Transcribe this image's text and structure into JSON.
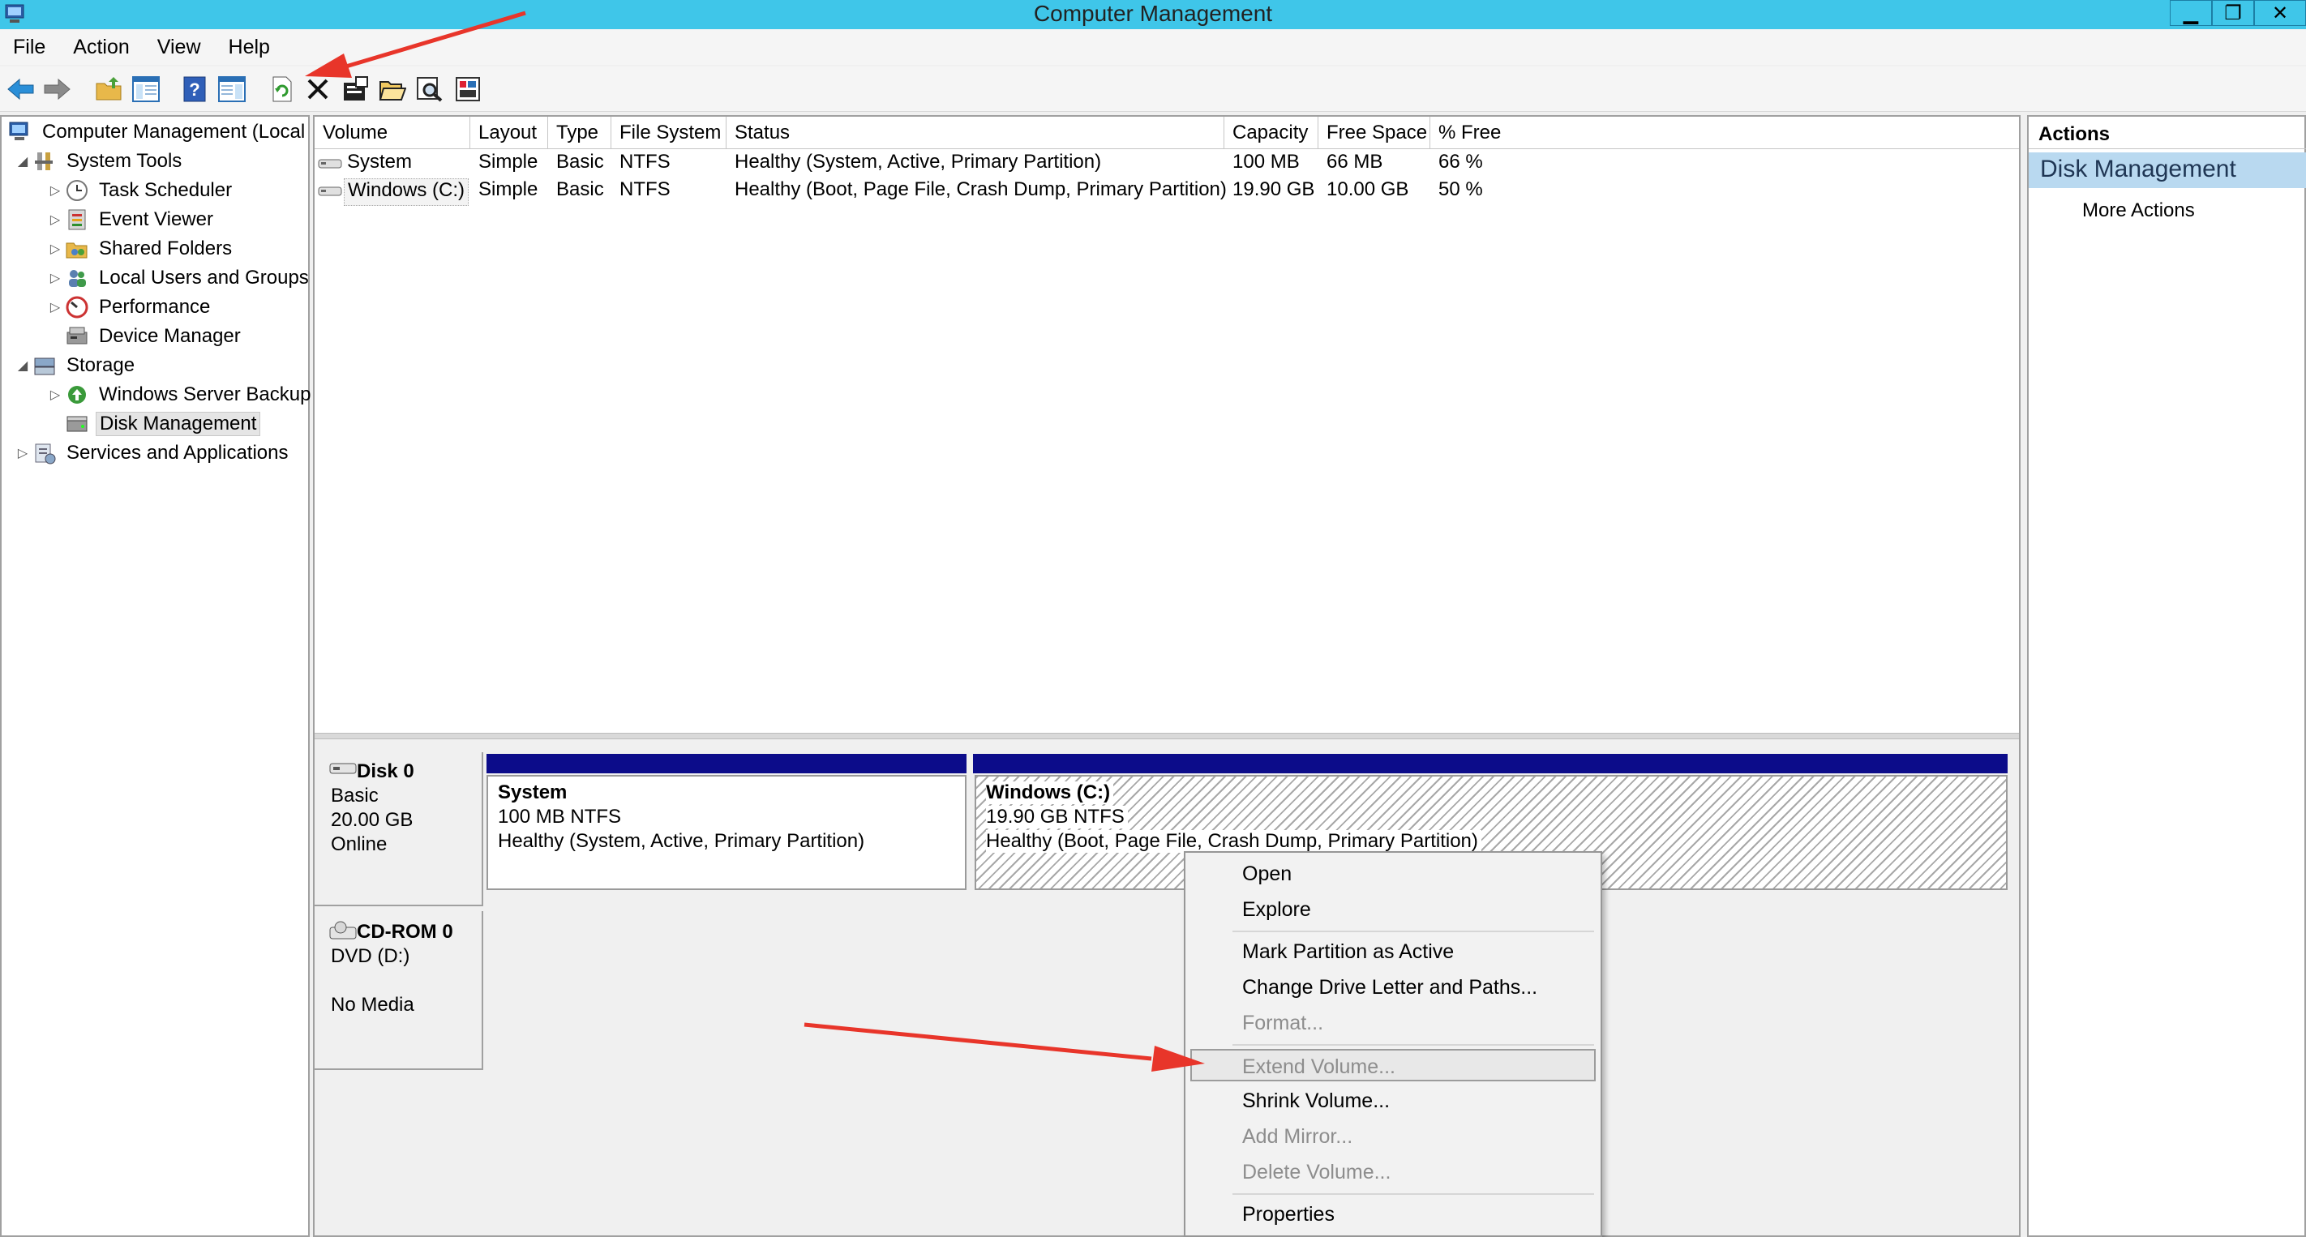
{
  "window": {
    "title": "Computer Management",
    "minimize_label": "▁",
    "restore_label": "❐",
    "close_label": "✕"
  },
  "menu": [
    "File",
    "Action",
    "View",
    "Help"
  ],
  "tree": [
    {
      "label": "Computer Management (Local",
      "icon": "computer-management-icon",
      "expander": ""
    },
    {
      "label": "System Tools",
      "icon": "system-tools-icon",
      "expander": "◢"
    },
    {
      "label": "Task Scheduler",
      "icon": "clock-icon",
      "expander": "▷"
    },
    {
      "label": "Event Viewer",
      "icon": "event-viewer-icon",
      "expander": "▷"
    },
    {
      "label": "Shared Folders",
      "icon": "shared-folders-icon",
      "expander": "▷"
    },
    {
      "label": "Local Users and Groups",
      "icon": "users-icon",
      "expander": "▷"
    },
    {
      "label": "Performance",
      "icon": "performance-icon",
      "expander": "▷"
    },
    {
      "label": "Device Manager",
      "icon": "device-manager-icon",
      "expander": ""
    },
    {
      "label": "Storage",
      "icon": "storage-icon",
      "expander": "◢"
    },
    {
      "label": "Windows Server Backup",
      "icon": "backup-icon",
      "expander": "▷"
    },
    {
      "label": "Disk Management",
      "icon": "disk-management-icon",
      "expander": ""
    },
    {
      "label": "Services and Applications",
      "icon": "services-icon",
      "expander": "▷"
    }
  ],
  "volume_table": {
    "columns": [
      "Volume",
      "Layout",
      "Type",
      "File System",
      "Status",
      "Capacity",
      "Free Space",
      "% Free"
    ],
    "rows": [
      [
        "System",
        "Simple",
        "Basic",
        "NTFS",
        "Healthy (System, Active, Primary Partition)",
        "100 MB",
        "66 MB",
        "66 %"
      ],
      [
        "Windows (C:)",
        "Simple",
        "Basic",
        "NTFS",
        "Healthy (Boot, Page File, Crash Dump, Primary Partition)",
        "19.90 GB",
        "10.00 GB",
        "50 %"
      ]
    ]
  },
  "disks": [
    {
      "name": "Disk 0",
      "lines": [
        "Basic",
        "20.00 GB",
        "Online"
      ]
    },
    {
      "name": "CD-ROM 0",
      "lines": [
        "DVD (D:)",
        "",
        "No Media"
      ]
    }
  ],
  "partitions": [
    {
      "name": "System",
      "size": "100 MB NTFS",
      "status": "Healthy (System, Active, Primary Partition)"
    },
    {
      "name": "Windows  (C:)",
      "size": "19.90 GB NTFS",
      "status": "Healthy (Boot, Page File, Crash Dump, Primary Partition)"
    }
  ],
  "actions": {
    "header": "Actions",
    "section": "Disk Management",
    "more": "More Actions"
  },
  "context_menu": {
    "items": [
      {
        "label": "Open",
        "enabled": true
      },
      {
        "label": "Explore",
        "enabled": true
      },
      {
        "label": "Mark Partition as Active",
        "enabled": true
      },
      {
        "label": "Change Drive Letter and Paths...",
        "enabled": true
      },
      {
        "label": "Format...",
        "enabled": false
      },
      {
        "label": "Extend Volume...",
        "enabled": false,
        "highlighted": true
      },
      {
        "label": "Shrink Volume...",
        "enabled": true
      },
      {
        "label": "Add Mirror...",
        "enabled": false
      },
      {
        "label": "Delete Volume...",
        "enabled": false
      },
      {
        "label": "Properties",
        "enabled": true
      }
    ]
  },
  "colors": {
    "titlebar": "#3fc6e9",
    "partition_header": "#0c0c8a",
    "annotation_arrow": "#e8352a",
    "actions_section": "#b9d9f0"
  }
}
